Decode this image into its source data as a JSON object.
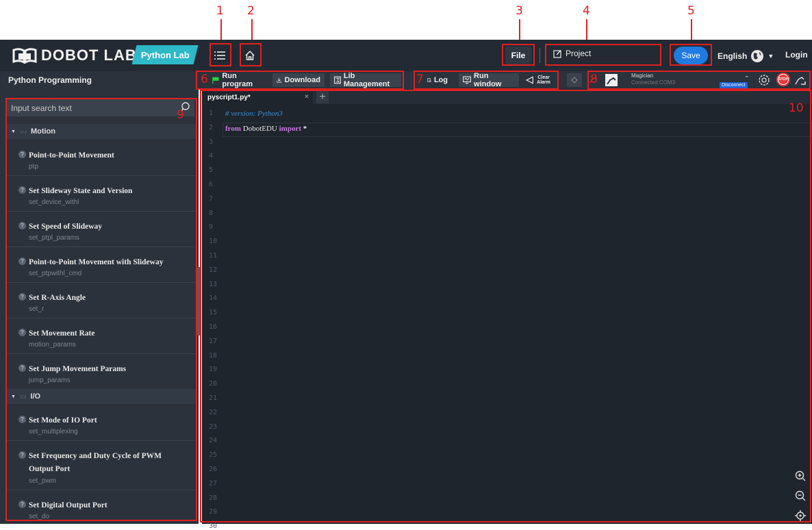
{
  "annotations": [
    "1",
    "2",
    "3",
    "4",
    "5",
    "6",
    "7",
    "8",
    "9",
    "10"
  ],
  "topbar": {
    "brand": "DOBOT LAB",
    "mode_badge": "Python Lab",
    "file_label": "File",
    "project_label": "Project",
    "save_label": "Save",
    "language": "English",
    "login_label": "Login",
    "icons": [
      "menu-icon",
      "home-icon",
      "edit-icon",
      "globe-icon"
    ]
  },
  "subbar": {
    "title": "Python Programming",
    "run_program": "Run program",
    "download": "Download",
    "lib_management": "Lib Management",
    "log": "Log",
    "run_window": "Run window",
    "clear_alarm_1": "Clear",
    "clear_alarm_2": "Alarm",
    "device_name": "Magician",
    "device_status": "Connected COM3",
    "disconnect": "Disconnect",
    "stop": "STOP"
  },
  "sidebar": {
    "search_placeholder": "Input search text",
    "categories": [
      {
        "label": "Motion"
      },
      {
        "label": "I/O"
      }
    ],
    "items": [
      {
        "title": "Point-to-Point Movement",
        "func": "ptp"
      },
      {
        "title": "Set Slideway State and Version",
        "func": "set_device_withl"
      },
      {
        "title": "Set Speed of Slideway",
        "func": "set_ptpl_params"
      },
      {
        "title": "Point-to-Point Movement with Slideway",
        "func": "set_ptpwithl_cmd"
      },
      {
        "title": "Set R-Axis Angle",
        "func": "set_r"
      },
      {
        "title": "Set Movement Rate",
        "func": "motion_params"
      },
      {
        "title": "Set Jump Movement Params",
        "func": "jump_params"
      },
      {
        "title": "Set Mode of IO Port",
        "func": "set_multiplexing"
      },
      {
        "title": "Set Frequency and Duty Cycle of PWM Output Port",
        "func": "set_pwm"
      },
      {
        "title": "Set Digital Output Port",
        "func": "set_do"
      }
    ]
  },
  "editor": {
    "tab_name": "pyscript1.py*",
    "tab_close": "×",
    "tab_add": "+",
    "line_count": 30,
    "line1": "# version: Python3",
    "line2_kw_from": "from",
    "line2_mod": "DobotEDU",
    "line2_kw_import": "import",
    "line2_star": "*"
  },
  "colors": {
    "annotation": "#e02020",
    "topbar_bg": "#232a33",
    "sidebar_bg": "#2b323c",
    "editor_bg": "#1f252d",
    "accent_teal": "#2fb8c8",
    "save_blue": "#1f7be0",
    "keyword": "#c678dd",
    "comment": "#3a8fd4",
    "run_flag": "#2ecc40",
    "stop_red": "#e8373c"
  }
}
